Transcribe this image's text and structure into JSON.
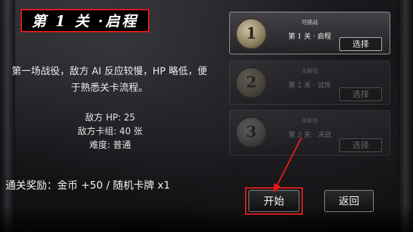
{
  "header": {
    "title": "第 1 关 ·启程"
  },
  "level": {
    "description": "第一场战役，敌方 AI 反应较慢，HP 略低，便于熟悉关卡流程。",
    "enemy_hp": "敌方 HP: 25",
    "enemy_deck": "敌方卡组: 40 张",
    "difficulty": "难度: 普通",
    "reward": "通关奖励：金币 +50 / 随机卡牌 x1"
  },
  "stage_list": [
    {
      "number": "1",
      "status": "可挑战",
      "name": "第 1 关 · 启程",
      "select_label": "选择",
      "locked": false
    },
    {
      "number": "2",
      "status": "未解锁",
      "name": "第 2 关 · 试炼",
      "select_label": "选择",
      "locked": true
    },
    {
      "number": "3",
      "status": "未解锁",
      "name": "第 3 关 · 决战",
      "select_label": "选择",
      "locked": true
    }
  ],
  "buttons": {
    "start": "开始",
    "back": "返回"
  },
  "colors": {
    "highlight": "#e31b1b",
    "panel_border": "#6b6b6b"
  }
}
